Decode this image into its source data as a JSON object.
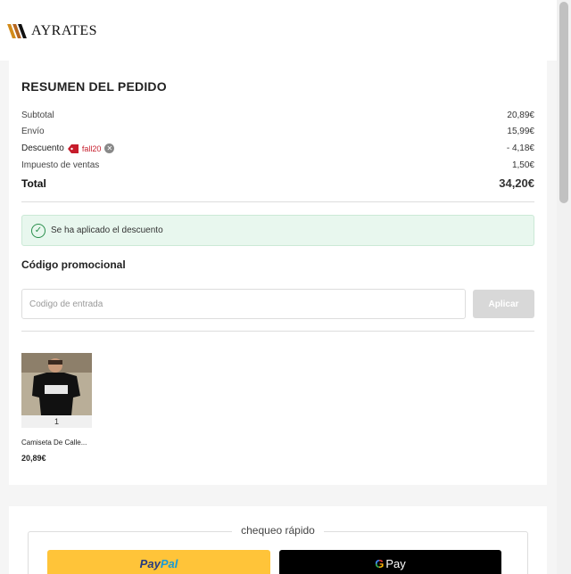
{
  "brand": {
    "name": "AYRATES",
    "colors": {
      "primary": "#d28b1a",
      "accent": "#b5661f"
    }
  },
  "summary": {
    "title": "RESUMEN DEL PEDIDO",
    "rows": [
      {
        "label": "Subtotal",
        "value": "20,89€"
      },
      {
        "label": "Envío",
        "value": "15,99€"
      },
      {
        "label": "Descuento",
        "value": "- 4,18€",
        "code": "fall20"
      },
      {
        "label": "Impuesto de ventas",
        "value": "1,50€"
      }
    ],
    "total": {
      "label": "Total",
      "value": "34,20€"
    },
    "success_message": "Se ha aplicado el descuento"
  },
  "promo": {
    "title": "Código promocional",
    "placeholder": "Codigo de entrada",
    "apply_label": "Aplicar"
  },
  "product": {
    "qty": "1",
    "name": "Camiseta De Calle...",
    "price": "20,89€"
  },
  "express": {
    "label": "chequeo rápido",
    "paypal": {
      "pay": "Pay",
      "pal": "Pal"
    },
    "gpay": {
      "g": "G",
      "pay": "Pay"
    }
  },
  "icons": [
    "logo-icon",
    "tag-icon",
    "remove-icon",
    "check-circle-icon"
  ]
}
